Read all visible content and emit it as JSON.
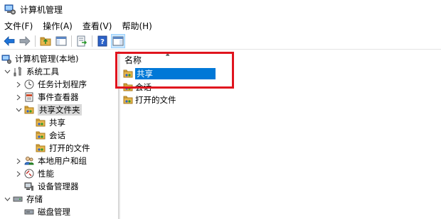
{
  "window": {
    "title": "计算机管理"
  },
  "menubar": {
    "items": [
      {
        "label": "文件(F)"
      },
      {
        "label": "操作(A)"
      },
      {
        "label": "查看(V)"
      },
      {
        "label": "帮助(H)"
      }
    ]
  },
  "toolbar": {
    "buttons": [
      {
        "icon": "back-arrow-icon"
      },
      {
        "icon": "forward-arrow-icon"
      },
      {
        "icon": "up-folder-icon"
      },
      {
        "icon": "show-hide-tree-icon"
      },
      {
        "icon": "export-list-icon"
      },
      {
        "icon": "help-icon"
      },
      {
        "icon": "action-pane-icon"
      }
    ]
  },
  "tree": {
    "root": {
      "label": "计算机管理(本地)"
    },
    "system_tools": {
      "label": "系统工具"
    },
    "task_scheduler": {
      "label": "任务计划程序"
    },
    "event_viewer": {
      "label": "事件查看器"
    },
    "shared_folders": {
      "label": "共享文件夹"
    },
    "shares": {
      "label": "共享"
    },
    "sessions": {
      "label": "会话"
    },
    "open_files": {
      "label": "打开的文件"
    },
    "local_users": {
      "label": "本地用户和组"
    },
    "performance": {
      "label": "性能"
    },
    "device_manager": {
      "label": "设备管理器"
    },
    "storage": {
      "label": "存储"
    },
    "disk_management": {
      "label": "磁盘管理"
    }
  },
  "list": {
    "column_header": "名称",
    "rows": [
      {
        "label": "共享",
        "selected": true
      },
      {
        "label": "会话",
        "selected": false
      },
      {
        "label": "打开的文件",
        "selected": false
      }
    ]
  },
  "colors": {
    "selection": "#0078d7",
    "annotation": "#e0141e",
    "folder": "#e8b64c"
  }
}
